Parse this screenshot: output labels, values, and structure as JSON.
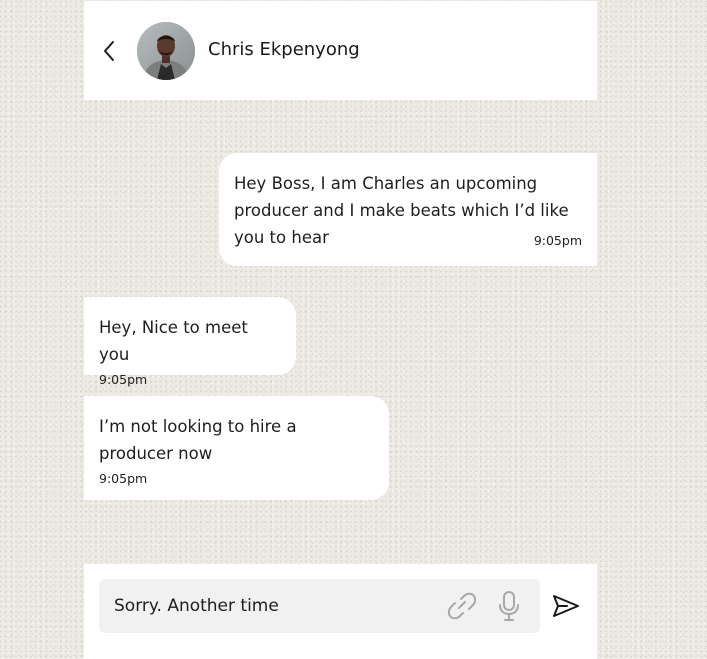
{
  "header": {
    "contact_name": "Chris Ekpenyong",
    "back_icon": "chevron-left-icon",
    "avatar_icon": "avatar-photo"
  },
  "messages": [
    {
      "direction": "sent",
      "text": "Hey Boss, I am Charles an upcoming producer and I make beats which I’d like you to hear",
      "time": "9:05pm"
    },
    {
      "direction": "received",
      "text": "Hey, Nice to meet you",
      "time": "9:05pm"
    },
    {
      "direction": "received",
      "text": "I’m not looking to hire a producer now",
      "time": "9:05pm"
    }
  ],
  "composer": {
    "input_value": "Sorry. Another time",
    "attach_icon": "paperclip-icon",
    "mic_icon": "microphone-icon",
    "send_icon": "send-icon"
  },
  "colors": {
    "background": "#eceae3",
    "bubble": "#ffffff",
    "input_background": "#f1f1f1",
    "muted_icon": "#a8a8a8"
  }
}
